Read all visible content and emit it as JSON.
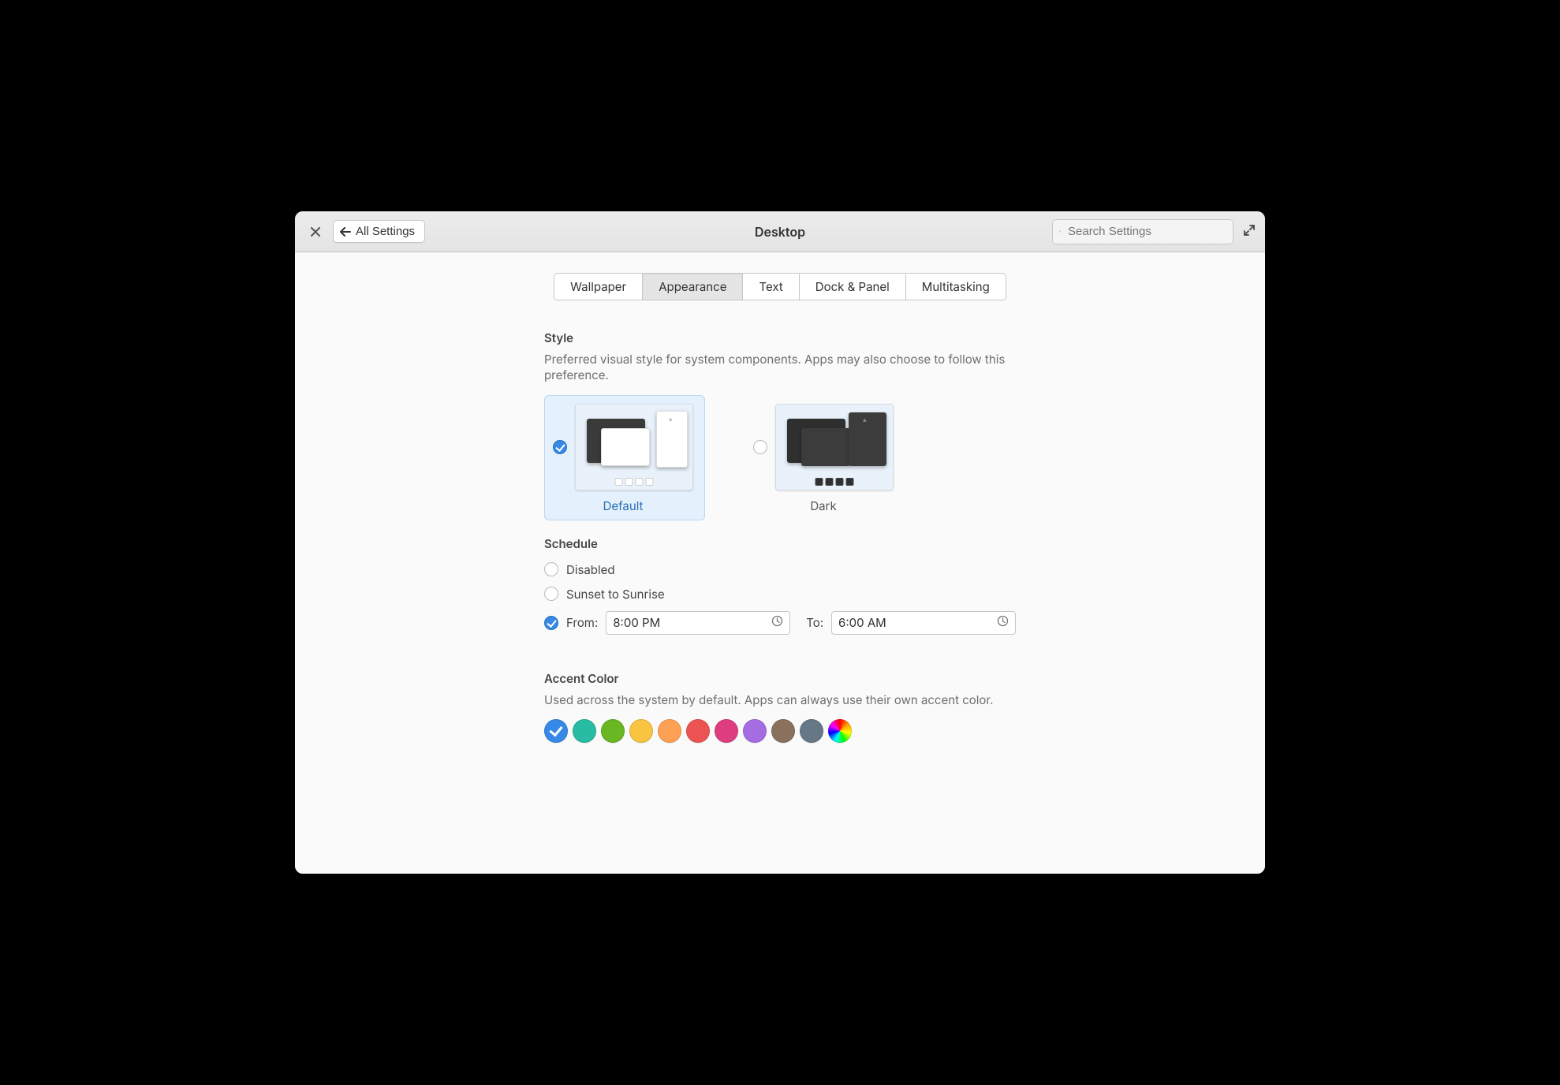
{
  "header": {
    "back_label": "All Settings",
    "title": "Desktop",
    "search_placeholder": "Search Settings"
  },
  "tabs": [
    "Wallpaper",
    "Appearance",
    "Text",
    "Dock & Panel",
    "Multitasking"
  ],
  "active_tab_index": 1,
  "style": {
    "title": "Style",
    "description": "Preferred visual style for system components. Apps may also choose to follow this preference.",
    "options": [
      {
        "label": "Default",
        "selected": true
      },
      {
        "label": "Dark",
        "selected": false
      }
    ]
  },
  "schedule": {
    "title": "Schedule",
    "options": {
      "disabled_label": "Disabled",
      "sunset_label": "Sunset to Sunrise",
      "from_label": "From:",
      "to_label": "To:",
      "from_value": "8:00 PM",
      "to_value": "6:00 AM",
      "selected": "from-to"
    }
  },
  "accent": {
    "title": "Accent Color",
    "description": "Used across the system by default. Apps can always use their own accent color.",
    "colors": [
      {
        "name": "blue",
        "hex": "#3689e6",
        "selected": true
      },
      {
        "name": "teal",
        "hex": "#28bca3",
        "selected": false
      },
      {
        "name": "green",
        "hex": "#68b723",
        "selected": false
      },
      {
        "name": "yellow",
        "hex": "#f9c440",
        "selected": false
      },
      {
        "name": "orange",
        "hex": "#ffa154",
        "selected": false
      },
      {
        "name": "red",
        "hex": "#ed5353",
        "selected": false
      },
      {
        "name": "pink",
        "hex": "#de3e80",
        "selected": false
      },
      {
        "name": "purple",
        "hex": "#a56de2",
        "selected": false
      },
      {
        "name": "brown",
        "hex": "#8a715e",
        "selected": false
      },
      {
        "name": "slate",
        "hex": "#667885",
        "selected": false
      },
      {
        "name": "auto",
        "hex": "",
        "selected": false
      }
    ]
  }
}
